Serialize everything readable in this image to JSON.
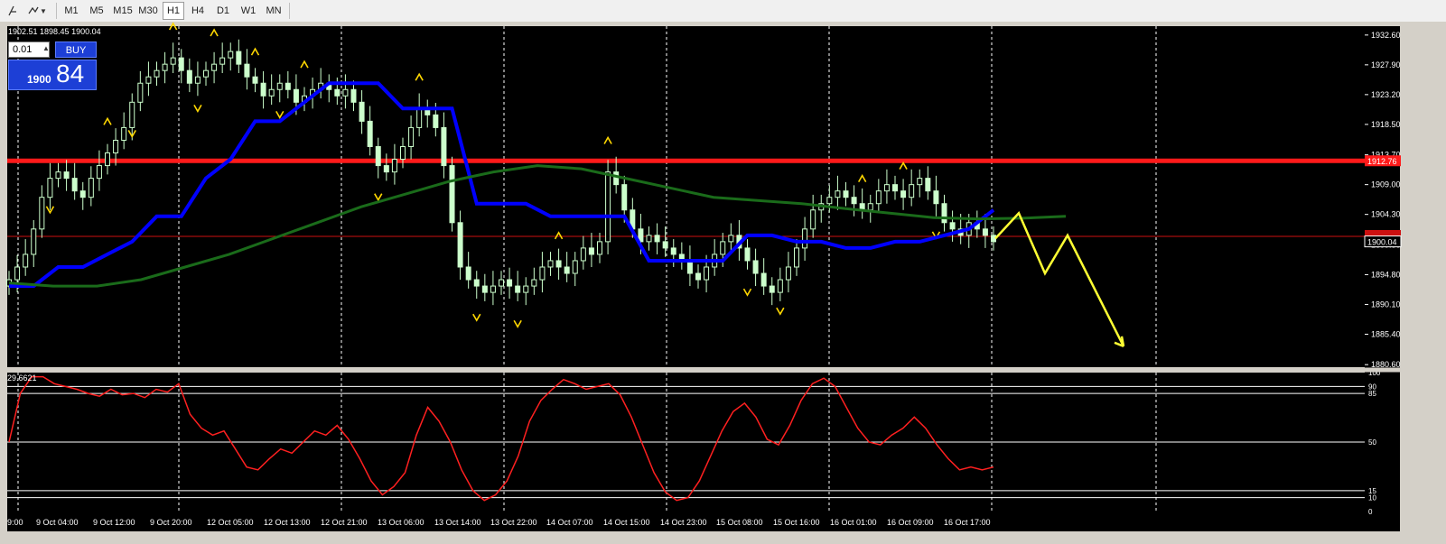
{
  "toolbar": {
    "icons": [
      "crosshair-icon",
      "objects-icon",
      "dropdown-arrow-icon"
    ],
    "timeframes": [
      "M1",
      "M5",
      "M15",
      "M30",
      "H1",
      "H4",
      "D1",
      "W1",
      "MN"
    ],
    "active_timeframe": "H1"
  },
  "ohlc_text": "1902.51 1898.45 1900.04",
  "trade": {
    "lot": "0.01",
    "buy_label": "BUY",
    "price_small": "1900",
    "price_big": "84"
  },
  "oscillator": {
    "value_label": "29.6621",
    "levels": [
      "100",
      "90",
      "85",
      "50",
      "15",
      "10",
      "0"
    ]
  },
  "colors": {
    "background": "#000000",
    "price_line": "#ff1a1a",
    "moving_average_fast": "#0000ff",
    "moving_average_slow": "#1a6b1a",
    "candle": "#ccffcc",
    "fractal": "#ffd700",
    "forecast_arrow": "#ffff33",
    "oscillator": "#ff2020"
  },
  "chart_data": {
    "type": "candlestick",
    "symbol_timeframe": "H1",
    "x_tick_labels": [
      "9 Oct 04:00",
      "9 Oct 12:00",
      "9 Oct 20:00",
      "12 Oct 05:00",
      "12 Oct 13:00",
      "12 Oct 21:00",
      "13 Oct 06:00",
      "13 Oct 14:00",
      "13 Oct 22:00",
      "14 Oct 07:00",
      "14 Oct 15:00",
      "14 Oct 23:00",
      "15 Oct 08:00",
      "15 Oct 16:00",
      "16 Oct 01:00",
      "16 Oct 09:00",
      "16 Oct 17:00"
    ],
    "first_x_label_fragment": "9:00",
    "y_tick_labels": [
      "1932.60",
      "1927.90",
      "1923.20",
      "1918.50",
      "1913.70",
      "1909.00",
      "1904.30",
      "1899.50",
      "1894.80",
      "1890.10",
      "1885.40",
      "1880.60"
    ],
    "ylim": [
      1880.2,
      1934.0
    ],
    "resistance_line": {
      "price": 1912.76,
      "label": "1912.76"
    },
    "bid_line": {
      "price": 1900.84,
      "label": "1900.84"
    },
    "current_price": {
      "price": 1900.04,
      "label": "1900.04"
    },
    "close_series": [
      1894,
      1896,
      1898,
      1902,
      1907,
      1910,
      1911,
      1910,
      1908,
      1907,
      1910,
      1912,
      1914,
      1916,
      1918,
      1922,
      1925,
      1926,
      1927,
      1928,
      1929,
      1927,
      1925,
      1926,
      1927,
      1928,
      1929,
      1930,
      1928,
      1926,
      1925,
      1923,
      1924,
      1925,
      1924,
      1922,
      1923,
      1924,
      1925,
      1924,
      1923,
      1924,
      1922,
      1919,
      1915,
      1912,
      1911,
      1913,
      1915,
      1918,
      1921,
      1920,
      1918,
      1912,
      1903,
      1896,
      1894,
      1893,
      1892,
      1893,
      1894,
      1893,
      1892,
      1893,
      1894,
      1896,
      1897,
      1896,
      1895,
      1897,
      1899,
      1898,
      1900,
      1911,
      1909,
      1905,
      1902,
      1900,
      1901,
      1900,
      1899,
      1898,
      1897,
      1895,
      1894,
      1896,
      1898,
      1900,
      1901,
      1899,
      1897,
      1895,
      1893,
      1892,
      1894,
      1896,
      1899,
      1902,
      1905,
      1906,
      1907,
      1908,
      1907,
      1906,
      1905,
      1906,
      1908,
      1909,
      1908,
      1907,
      1909,
      1910,
      1908,
      1906,
      1903,
      1902,
      1901,
      1903,
      1902,
      1901,
      1900
    ],
    "ma_fast_y": [
      1893,
      1893,
      1896,
      1896,
      1898,
      1900,
      1904,
      1904,
      1910,
      1913,
      1919,
      1919,
      1922,
      1925,
      1925,
      1925,
      1921,
      1921,
      1921,
      1906,
      1906,
      1906,
      1904,
      1904,
      1904,
      1904,
      1897,
      1897,
      1897,
      1897,
      1901,
      1901,
      1900,
      1900,
      1899,
      1899,
      1900,
      1900,
      1901,
      1902,
      1905
    ],
    "ma_slow_y": [
      1893.5,
      1893,
      1893,
      1894,
      1896,
      1898,
      1900.5,
      1903,
      1905.5,
      1907.5,
      1909.5,
      1911,
      1912,
      1911.5,
      1910,
      1908.5,
      1907,
      1906.5,
      1906,
      1905.2,
      1904.5,
      1903.8,
      1903.6,
      1903.7,
      1904
    ],
    "forecast_path": [
      1900.5,
      1904.5,
      1895,
      1901,
      1883.5
    ],
    "oscillator_series": [
      50,
      85,
      97,
      97,
      92,
      90,
      88,
      85,
      83,
      88,
      84,
      85,
      82,
      88,
      86,
      92,
      70,
      60,
      55,
      58,
      45,
      32,
      30,
      38,
      45,
      42,
      50,
      58,
      55,
      62,
      52,
      38,
      22,
      12,
      18,
      28,
      55,
      75,
      65,
      50,
      30,
      15,
      8,
      12,
      22,
      40,
      65,
      80,
      88,
      95,
      92,
      88,
      90,
      92,
      84,
      68,
      48,
      28,
      14,
      8,
      10,
      22,
      40,
      58,
      72,
      78,
      68,
      52,
      48,
      62,
      80,
      92,
      96,
      90,
      75,
      60,
      50,
      48,
      55,
      60,
      68,
      60,
      48,
      38,
      30,
      32,
      30,
      32
    ],
    "oscillator_ylim": [
      0,
      100
    ]
  }
}
